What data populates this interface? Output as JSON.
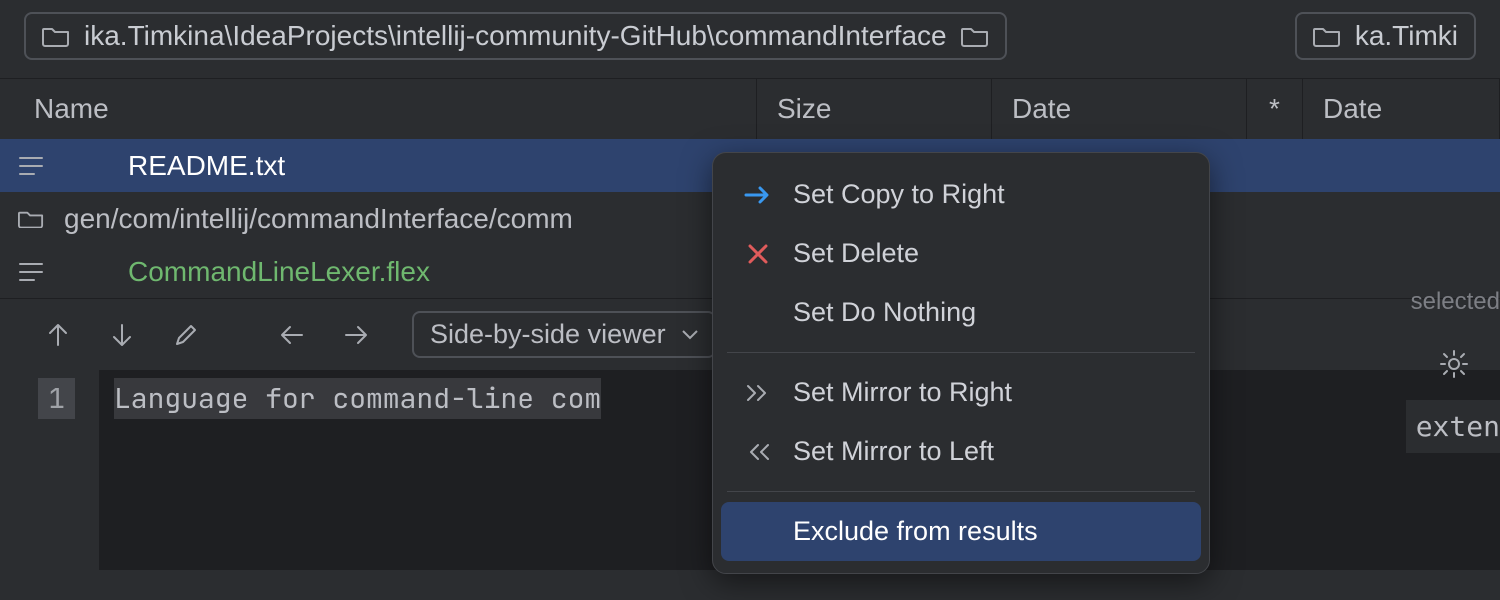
{
  "path_bar": {
    "left_path": "ika.Timkina\\IdeaProjects\\intellij-community-GitHub\\commandInterface",
    "right_path": "ka.Timki"
  },
  "columns": {
    "name": "Name",
    "size": "Size",
    "date": "Date",
    "star": "*",
    "date2": "Date"
  },
  "files": [
    {
      "name": "README.txt",
      "selected": true,
      "type": "file"
    },
    {
      "name": "gen/com/intellij/commandInterface/comm",
      "type": "folder"
    },
    {
      "name": "CommandLineLexer.flex",
      "type": "file-green"
    }
  ],
  "toolbar": {
    "viewer_label": "Side-by-side viewer"
  },
  "editor": {
    "line_no": "1",
    "line_text": "Language for command-line com"
  },
  "right_hints": {
    "selected": "selected",
    "code": "exten"
  },
  "context_menu": {
    "copy_right": "Set Copy to Right",
    "delete": "Set Delete",
    "do_nothing": "Set Do Nothing",
    "mirror_right": "Set Mirror to Right",
    "mirror_left": "Set Mirror to Left",
    "exclude": "Exclude from results"
  }
}
